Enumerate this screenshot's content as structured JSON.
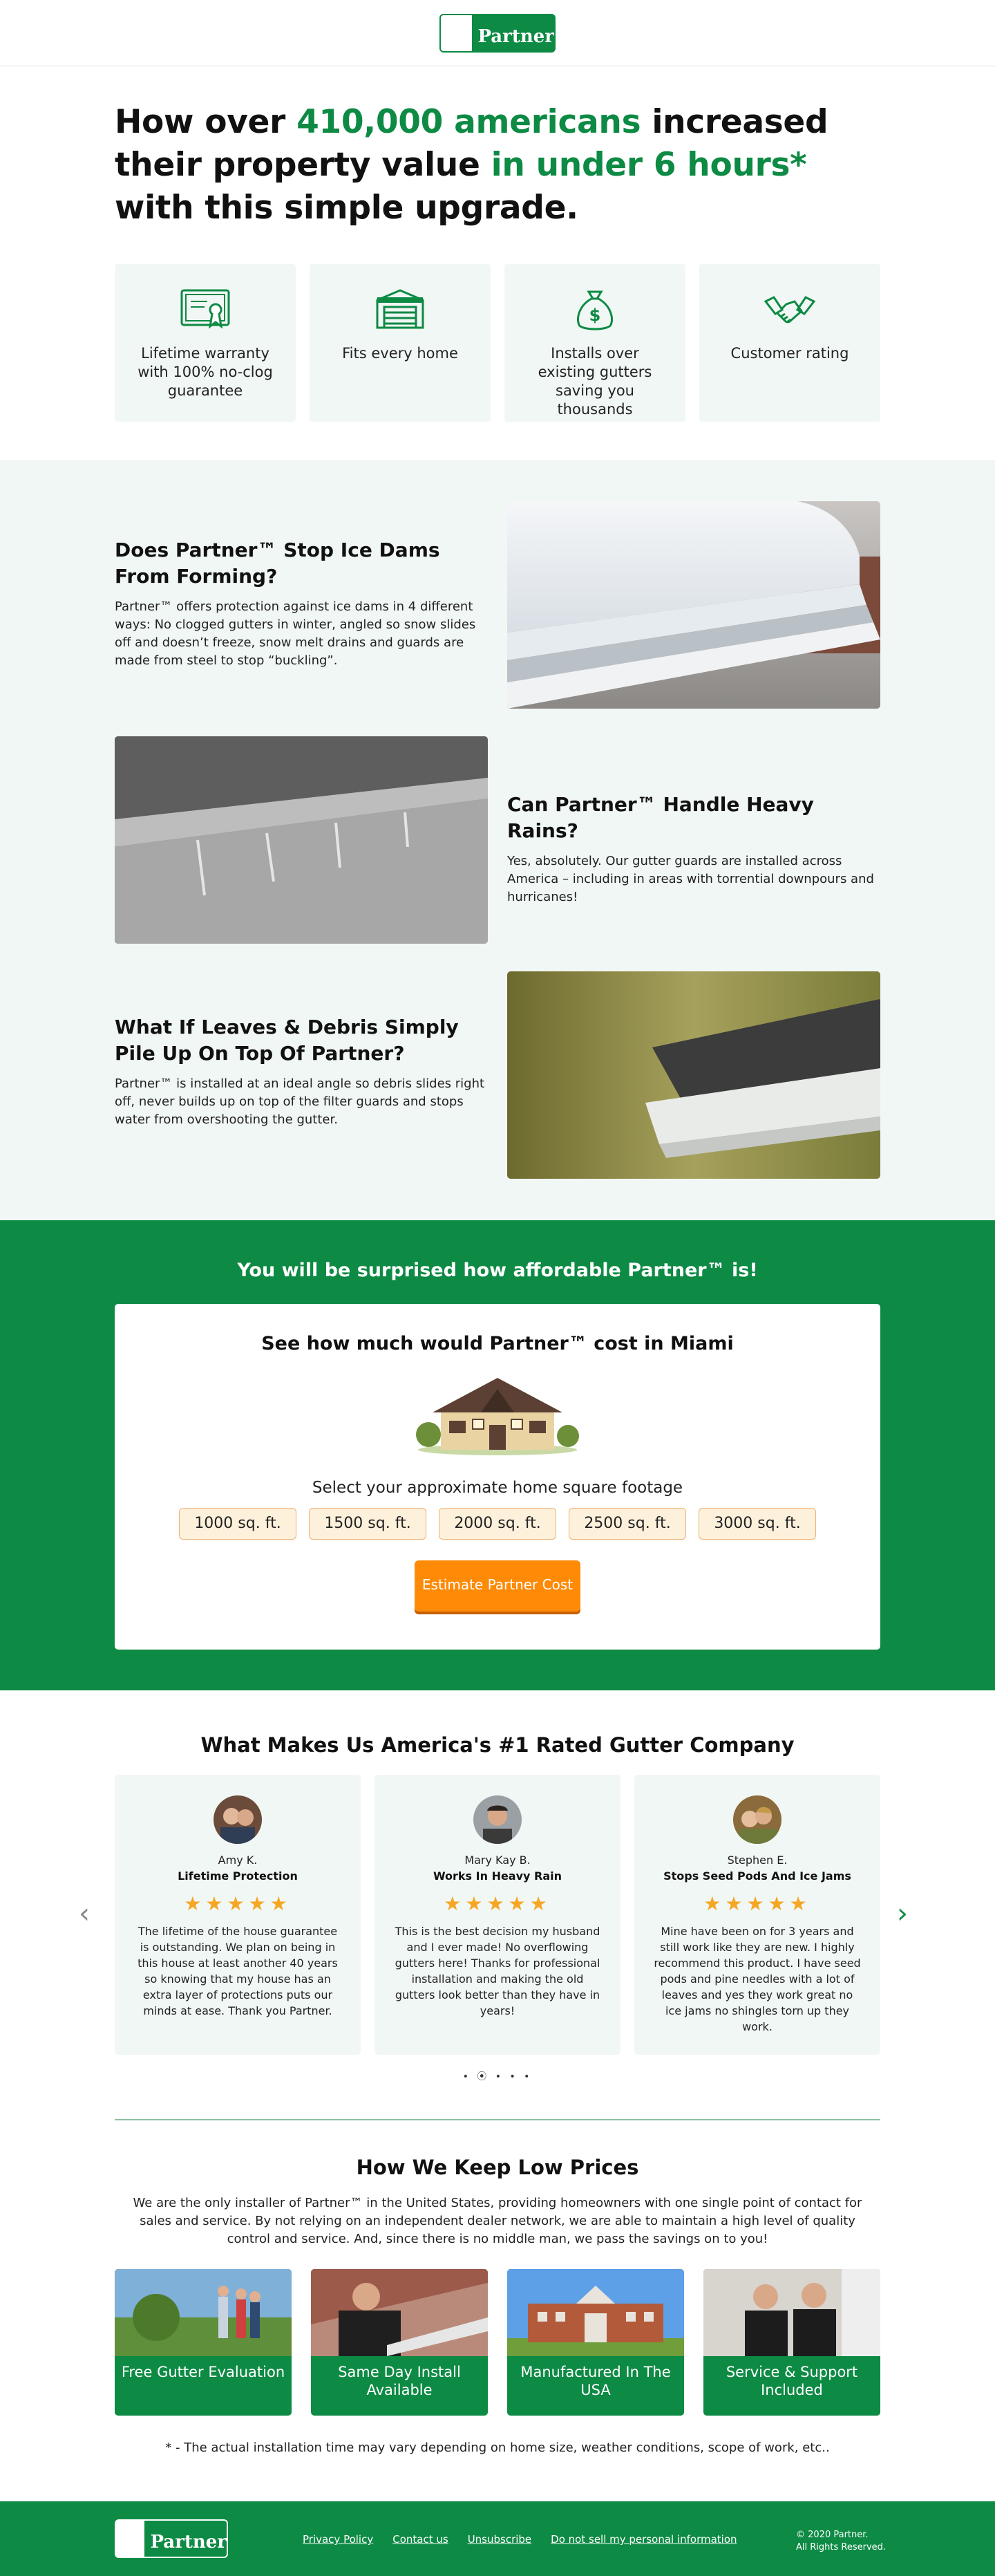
{
  "header": {
    "logo_text": "Partner"
  },
  "hero": {
    "title_p1": "How over ",
    "title_g1": "410,000 americans",
    "title_p2": " increased their property value ",
    "title_g2": "in under 6 hours*",
    "title_p3": " with this simple upgrade."
  },
  "features": [
    {
      "icon": "certificate-icon",
      "text": "Lifetime warranty with 100% no-clog guarantee"
    },
    {
      "icon": "garage-home-icon",
      "text": "Fits every home"
    },
    {
      "icon": "money-bag-icon",
      "text": "Installs over existing gutters saving you thousands"
    },
    {
      "icon": "handshake-icon",
      "text": "Customer rating"
    }
  ],
  "faq": [
    {
      "title": "Does Partner™ Stop Ice Dams From Forming?",
      "body": "Partner™ offers protection against ice dams in 4 different ways: No clogged gutters in winter, angled so snow slides off and doesn’t freeze, snow melt drains and guards are made from steel to stop “buckling”."
    },
    {
      "title": "Can Partner™ Handle Heavy Rains?",
      "body": "Yes, absolutely. Our gutter guards are installed across America – including in areas with torrential downpours and hurricanes!"
    },
    {
      "title": "What If Leaves & Debris Simply Pile Up On Top Of Partner?",
      "body": "Partner™ is installed at an ideal angle so debris slides right off, never builds up on top of the filter guards and stops water from overshooting the gutter."
    }
  ],
  "estimate": {
    "headline": "You will be surprised how affordable Partner™ is!",
    "card_title": "See how much would Partner™ cost in Miami",
    "select_label": "Select your approximate home square footage",
    "sizes": [
      "1000 sq. ft.",
      "1500 sq. ft.",
      "2000 sq. ft.",
      "2500 sq. ft.",
      "3000 sq. ft."
    ],
    "button": "Estimate Partner Cost"
  },
  "testimonials": {
    "title": "What Makes Us America's #1 Rated Gutter Company",
    "items": [
      {
        "name": "Amy K.",
        "title": "Lifetime Protection",
        "stars": "★★★★★",
        "quote": "The lifetime of the house guarantee is outstanding. We plan on being in this house at least another 40 years so knowing that my house has an extra layer of protections puts our minds at ease. Thank you Partner."
      },
      {
        "name": "Mary Kay B.",
        "title": "Works In Heavy Rain",
        "stars": "★★★★★",
        "quote": "This is the best decision my husband and I ever made! No overflowing gutters here! Thanks for professional installation and making the old gutters look better than they have in years!"
      },
      {
        "name": "Stephen E.",
        "title": "Stops Seed Pods And Ice Jams",
        "stars": "★★★★★",
        "quote": "Mine have been on for 3 years and still work like they are new. I highly recommend this product. I have seed pods and pine needles with a lot of leaves and yes they work great no ice jams no shingles torn up they work."
      }
    ],
    "prev": "‹",
    "next": "›",
    "dots": "• ⦿ • • •"
  },
  "prices": {
    "title": "How We Keep Low Prices",
    "body": "We are the only installer of Partner™ in the United States, providing homeowners with one single point of contact for sales and service. By not relying on an independent dealer network, we are able to maintain a high level of quality control and service. And, since there is no middle man, we pass the savings on to you!",
    "cards": [
      "Free Gutter Evaluation",
      "Same Day Install Available",
      "Manufactured In The USA",
      "Service & Support Included"
    ]
  },
  "note": "* - The actual installation time may vary depending on home size, weather conditions, scope of work, etc..",
  "footer": {
    "logo_text": "Partner",
    "links": [
      "Privacy Policy",
      "Contact us",
      "Unsubscribe",
      "Do not sell my personal information"
    ],
    "copy1": "© 2020 Partner.",
    "copy2": "All Rights Reserved."
  }
}
